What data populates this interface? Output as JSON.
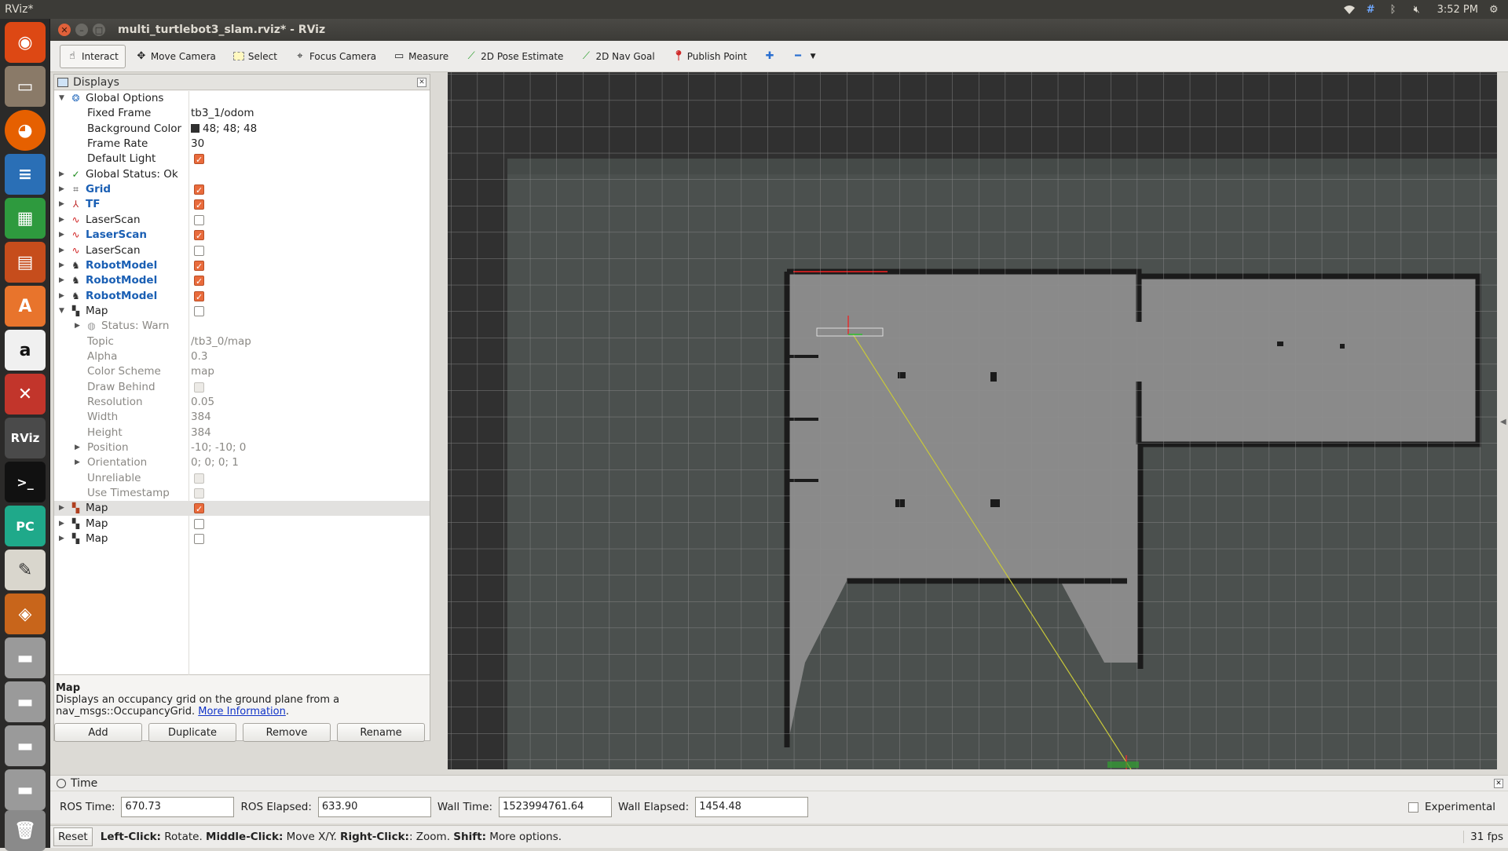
{
  "top_panel": {
    "app_name": "RViz*",
    "clock": "3:52 PM"
  },
  "window": {
    "title": "multi_turtlebot3_slam.rviz* - RViz"
  },
  "toolbar": {
    "tools": [
      {
        "label": "Interact",
        "icon": "hand-icon",
        "active": true
      },
      {
        "label": "Move Camera",
        "icon": "move-camera-icon"
      },
      {
        "label": "Select",
        "icon": "select-icon"
      },
      {
        "label": "Focus Camera",
        "icon": "focus-camera-icon"
      },
      {
        "label": "Measure",
        "icon": "measure-icon"
      },
      {
        "label": "2D Pose Estimate",
        "icon": "pose-estimate-icon"
      },
      {
        "label": "2D Nav Goal",
        "icon": "nav-goal-icon"
      },
      {
        "label": "Publish Point",
        "icon": "publish-point-icon"
      }
    ]
  },
  "displays": {
    "title": "Displays",
    "rows": [
      {
        "name": "Global Options",
        "indent": 0,
        "expanded": true,
        "icon": "globe-icon"
      },
      {
        "name": "Fixed Frame",
        "indent": 1,
        "value": "tb3_1/odom"
      },
      {
        "name": "Background Color",
        "indent": 1,
        "value": "48; 48; 48",
        "swatch": true
      },
      {
        "name": "Frame Rate",
        "indent": 1,
        "value": "30"
      },
      {
        "name": "Default Light",
        "indent": 1,
        "checkbox": "on"
      },
      {
        "name": "Global Status: Ok",
        "indent": 0,
        "collapsed": true,
        "icon": "check-icon"
      },
      {
        "name": "Grid",
        "indent": 0,
        "collapsed": true,
        "icon": "grid-icon",
        "style": "blue",
        "checkbox": "on"
      },
      {
        "name": "TF",
        "indent": 0,
        "collapsed": true,
        "icon": "tf-icon",
        "style": "blue",
        "checkbox": "on"
      },
      {
        "name": "LaserScan",
        "indent": 0,
        "collapsed": true,
        "icon": "laserscan-icon",
        "checkbox": "off"
      },
      {
        "name": "LaserScan",
        "indent": 0,
        "collapsed": true,
        "icon": "laserscan-icon",
        "style": "blue",
        "checkbox": "on"
      },
      {
        "name": "LaserScan",
        "indent": 0,
        "collapsed": true,
        "icon": "laserscan-icon",
        "checkbox": "off"
      },
      {
        "name": "RobotModel",
        "indent": 0,
        "collapsed": true,
        "icon": "robot-icon",
        "style": "blue",
        "checkbox": "on"
      },
      {
        "name": "RobotModel",
        "indent": 0,
        "collapsed": true,
        "icon": "robot-icon",
        "style": "blue",
        "checkbox": "on"
      },
      {
        "name": "RobotModel",
        "indent": 0,
        "collapsed": true,
        "icon": "robot-icon",
        "style": "blue",
        "checkbox": "on"
      },
      {
        "name": "Map",
        "indent": 0,
        "expanded": true,
        "icon": "map-icon",
        "checkbox": "off"
      },
      {
        "name": "Status: Warn",
        "indent": 1,
        "collapsed": true,
        "icon": "warn-icon",
        "style": "grey"
      },
      {
        "name": "Topic",
        "indent": 1,
        "value": "/tb3_0/map",
        "style": "grey"
      },
      {
        "name": "Alpha",
        "indent": 1,
        "value": "0.3",
        "style": "grey"
      },
      {
        "name": "Color Scheme",
        "indent": 1,
        "value": "map",
        "style": "grey"
      },
      {
        "name": "Draw Behind",
        "indent": 1,
        "checkbox": "disabled",
        "style": "grey"
      },
      {
        "name": "Resolution",
        "indent": 1,
        "value": "0.05",
        "style": "grey"
      },
      {
        "name": "Width",
        "indent": 1,
        "value": "384",
        "style": "grey"
      },
      {
        "name": "Height",
        "indent": 1,
        "value": "384",
        "style": "grey"
      },
      {
        "name": "Position",
        "indent": 1,
        "collapsed": true,
        "value": "-10; -10; 0",
        "style": "grey"
      },
      {
        "name": "Orientation",
        "indent": 1,
        "collapsed": true,
        "value": "0; 0; 0; 1",
        "style": "grey"
      },
      {
        "name": "Unreliable",
        "indent": 1,
        "checkbox": "disabled",
        "style": "grey"
      },
      {
        "name": "Use Timestamp",
        "indent": 1,
        "checkbox": "disabled",
        "style": "grey"
      },
      {
        "name": "Map",
        "indent": 0,
        "collapsed": true,
        "icon": "map-icon-color",
        "checkbox": "on",
        "selected": true
      },
      {
        "name": "Map",
        "indent": 0,
        "collapsed": true,
        "icon": "map-icon",
        "checkbox": "off"
      },
      {
        "name": "Map",
        "indent": 0,
        "collapsed": true,
        "icon": "map-icon",
        "checkbox": "off"
      }
    ],
    "description": {
      "title": "Map",
      "text": "Displays an occupancy grid on the ground plane from a nav_msgs::OccupancyGrid.",
      "link": "More Information"
    },
    "buttons": {
      "add": "Add",
      "duplicate": "Duplicate",
      "remove": "Remove",
      "rename": "Rename"
    }
  },
  "time": {
    "title": "Time",
    "ros_time_label": "ROS Time:",
    "ros_time": "670.73",
    "ros_elapsed_label": "ROS Elapsed:",
    "ros_elapsed": "633.90",
    "wall_time_label": "Wall Time:",
    "wall_time": "1523994761.64",
    "wall_elapsed_label": "Wall Elapsed:",
    "wall_elapsed": "1454.48",
    "experimental": "Experimental"
  },
  "status": {
    "reset": "Reset",
    "k1": "Left-Click:",
    "v1": " Rotate. ",
    "k2": "Middle-Click:",
    "v2": " Move X/Y. ",
    "k3": "Right-Click:",
    "v3": ": Zoom. ",
    "k4": "Shift:",
    "v4": " More options.",
    "fps": "31 fps"
  },
  "colors": {
    "background": "#303030",
    "accent": "#e96b3c",
    "grid": "#a0a0a0",
    "map_free": "#8a8a8a",
    "map_occupied": "#1a1a1a"
  }
}
